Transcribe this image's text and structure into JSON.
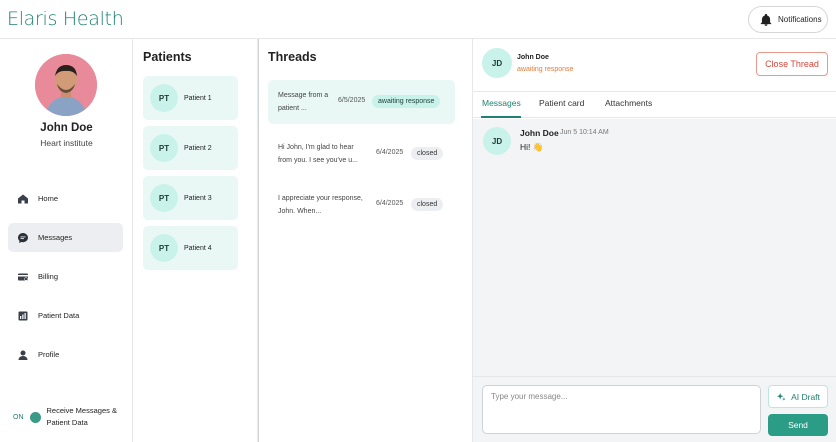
{
  "app": {
    "logo": "Elaris Health",
    "notifications_label": "Notifications"
  },
  "user": {
    "name": "John Doe",
    "org": "Heart institute"
  },
  "nav": [
    {
      "label": "Home",
      "icon": "home-icon"
    },
    {
      "label": "Messages",
      "icon": "messages-icon",
      "active": true
    },
    {
      "label": "Billing",
      "icon": "billing-icon"
    },
    {
      "label": "Patient Data",
      "icon": "patient-data-icon"
    },
    {
      "label": "Profile",
      "icon": "profile-icon"
    }
  ],
  "toggle": {
    "state_label": "ON",
    "label": "Receive Messages & Patient Data"
  },
  "patients": {
    "title": "Patients",
    "items": [
      {
        "initials": "PT",
        "name": "Patient 1"
      },
      {
        "initials": "PT",
        "name": "Patient 2"
      },
      {
        "initials": "PT",
        "name": "Patient 3"
      },
      {
        "initials": "PT",
        "name": "Patient 4"
      }
    ]
  },
  "threads": {
    "title": "Threads",
    "items": [
      {
        "snippet": "Message from a patient ...",
        "date": "6/5/2025",
        "status": "awaiting response"
      },
      {
        "snippet": "Hi John, I'm glad to hear from you. I see you've u...",
        "date": "6/4/2025",
        "status": "closed"
      },
      {
        "snippet": "I appreciate your response, John. When...",
        "date": "6/4/2025",
        "status": "closed"
      }
    ]
  },
  "detail": {
    "initials": "JD",
    "name": "John Doe",
    "status": "awaiting response",
    "close_label": "Close Thread",
    "tabs": [
      "Messages",
      "Patient card",
      "Attachments"
    ],
    "messages": [
      {
        "initials": "JD",
        "sender": "John Doe",
        "time": "Jun 5 10:14 AM",
        "text": "Hi! 👋"
      }
    ],
    "composer": {
      "placeholder": "Type your message...",
      "ai_label": "AI Draft",
      "send_label": "Send"
    }
  },
  "colors": {
    "brand": "#1f7f72",
    "accent_light": "#e9f8f5",
    "badge": "#c9f2ea",
    "warning": "#e8793a",
    "danger": "#d9463a",
    "send": "#2b9c86"
  }
}
